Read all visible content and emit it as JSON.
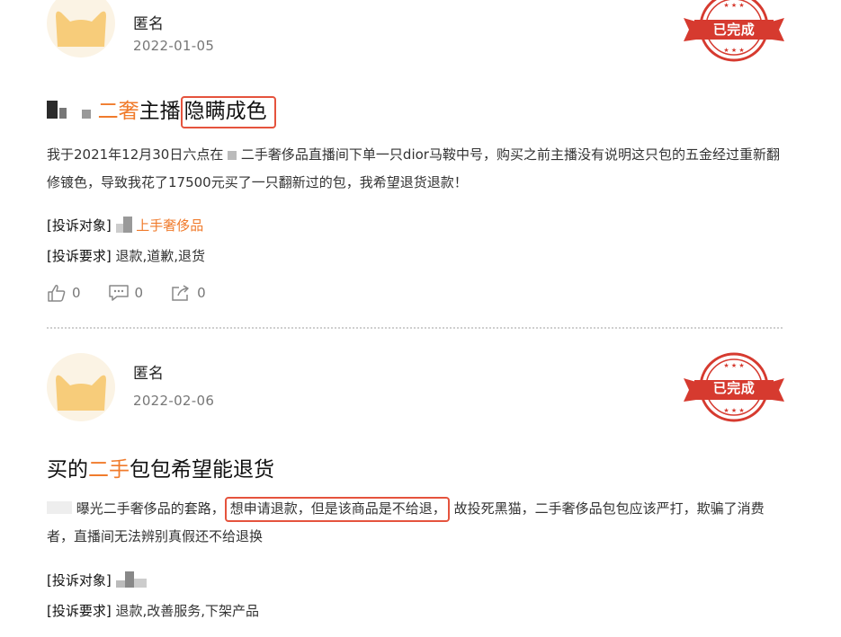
{
  "posts": [
    {
      "author": "匿名",
      "date": "2022-01-05",
      "status": "已完成",
      "title_highlight": "二奢",
      "title_mid": "主播",
      "title_boxed": "隐瞒成色",
      "body_part1": "我于2021年12月30日六点在",
      "body_part2": "二手奢侈品直播间下单一只dior马鞍中号，购买之前主播没有说明这只包的五金经过重新翻修镀色，导致我花了17500元买了一只翻新过的包，我希望退货退款！",
      "target_label": "[投诉对象]",
      "target_value": "上手奢侈品",
      "demand_label": "[投诉要求]",
      "demand_value": "退款,道歉,退货",
      "likes": "0",
      "comments": "0",
      "shares": "0"
    },
    {
      "author": "匿名",
      "date": "2022-02-06",
      "status": "已完成",
      "title_pre": "买的",
      "title_highlight": "二手",
      "title_post": "包包希望能退货",
      "body_part1": "曝光二手奢侈品的套路，",
      "body_boxed": "想申请退款，但是该商品是不给退，",
      "body_part2": "故投死黑猫，二手奢侈品包包应该严打，欺骗了消费者，直播间无法辨别真假还不给退换",
      "target_label": "[投诉对象]",
      "demand_label": "[投诉要求]",
      "demand_value": "退款,改善服务,下架产品"
    }
  ],
  "colors": {
    "accent": "#f07b2c",
    "stamp_red": "#d63a2f",
    "box_red": "#e5533d"
  }
}
